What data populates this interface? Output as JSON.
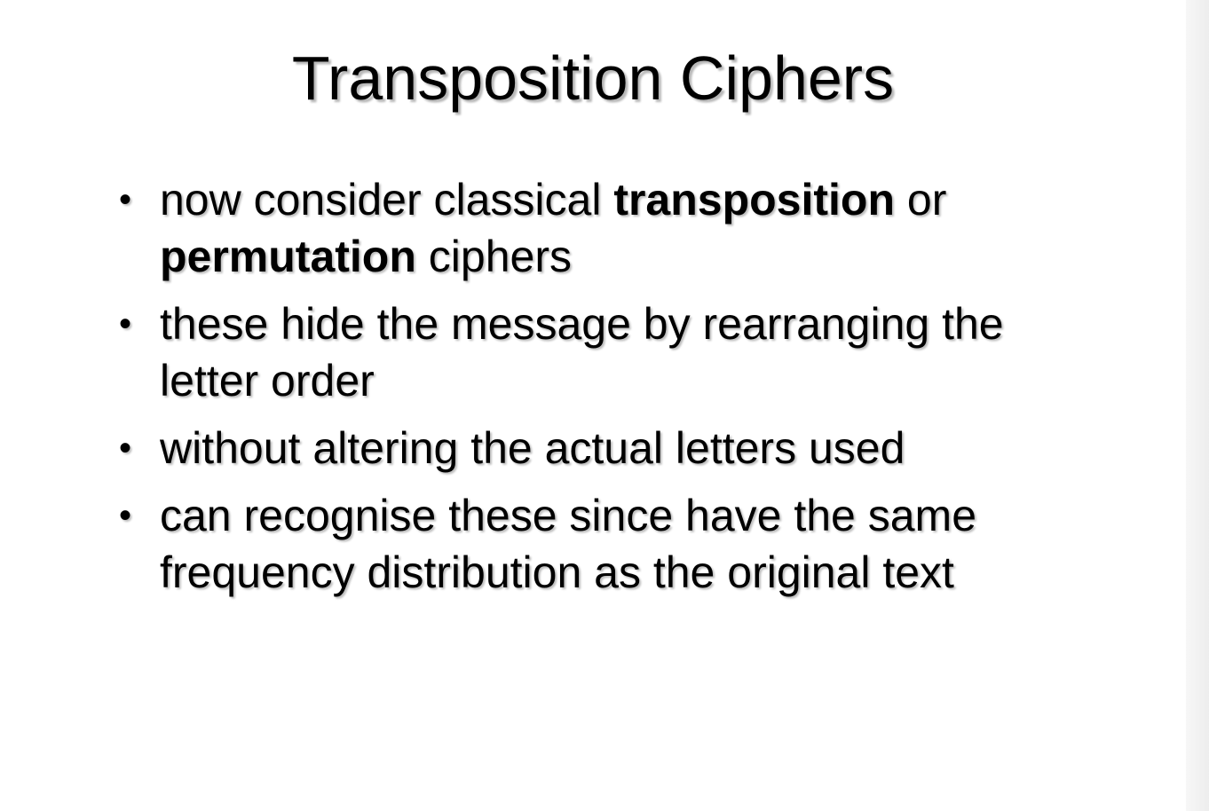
{
  "slide": {
    "title": "Transposition Ciphers",
    "bullets": [
      {
        "parts": [
          "now consider classical ",
          "transposition",
          " or ",
          "permutation",
          " ciphers"
        ]
      },
      {
        "text": "these hide the message by rearranging the letter order"
      },
      {
        "text": "without altering the actual letters used"
      },
      {
        "text": "can recognise these since have the same frequency distribution as the original text"
      }
    ],
    "bullet_symbol": "•"
  }
}
